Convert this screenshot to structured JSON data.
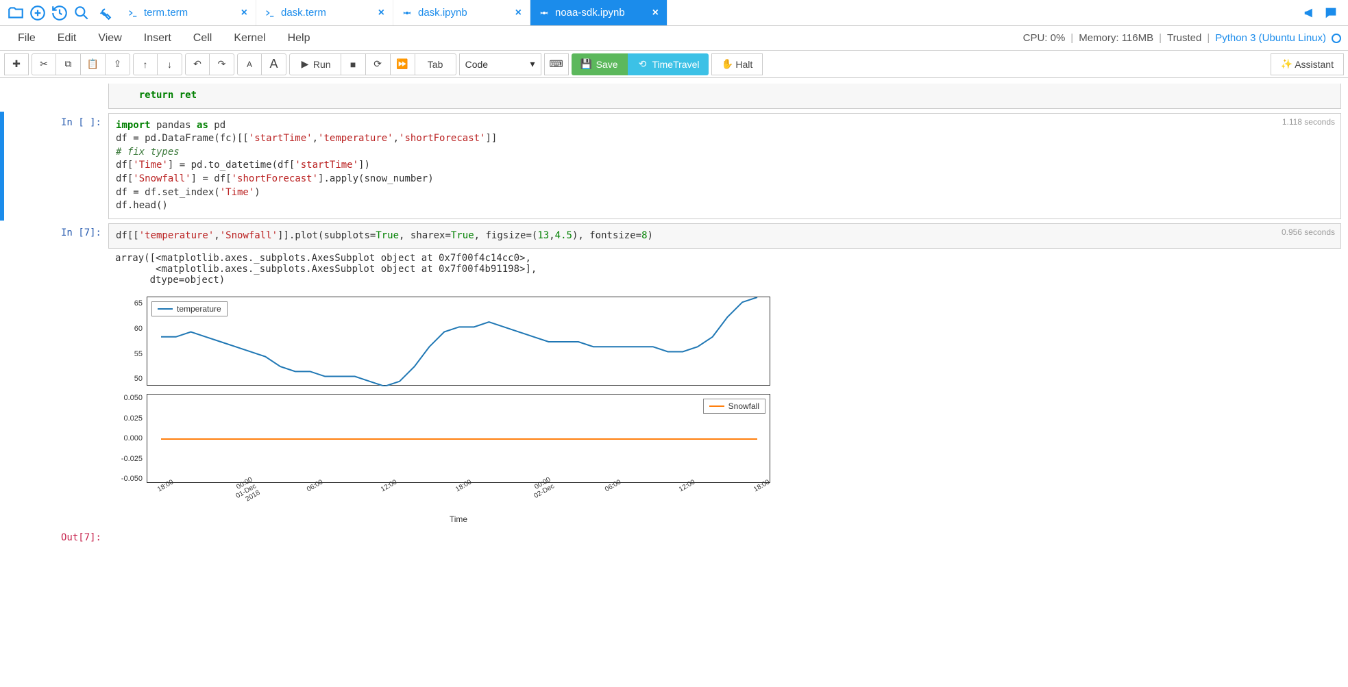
{
  "tabs": [
    {
      "label": "term.term",
      "icon": "terminal"
    },
    {
      "label": "dask.term",
      "icon": "terminal"
    },
    {
      "label": "dask.ipynb",
      "icon": "jupyter"
    },
    {
      "label": "noaa-sdk.ipynb",
      "icon": "jupyter",
      "active": true
    }
  ],
  "menubar": [
    "File",
    "Edit",
    "View",
    "Insert",
    "Cell",
    "Kernel",
    "Help"
  ],
  "status": {
    "cpu": "CPU: 0%",
    "memory": "Memory: 116MB",
    "trusted": "Trusted",
    "kernel": "Python 3 (Ubuntu Linux)"
  },
  "toolbar": {
    "run": "Run",
    "tab": "Tab",
    "celltype": "Code",
    "save": "Save",
    "timetravel": "TimeTravel",
    "halt": "Halt",
    "assistant": "Assistant"
  },
  "cells": {
    "prev_tail": "    return ret",
    "c1": {
      "prompt": "In [ ]:",
      "timing": "1.118 seconds",
      "lines": {
        "l1a": "import",
        "l1b": " pandas ",
        "l1c": "as",
        "l1d": " pd",
        "l2a": "df = pd.DataFrame(fc)[[",
        "l2b": "'startTime'",
        "l2c": ",",
        "l2d": "'temperature'",
        "l2e": ",",
        "l2f": "'shortForecast'",
        "l2g": "]]",
        "l3": "# fix types",
        "l4a": "df[",
        "l4b": "'Time'",
        "l4c": "] = pd.to_datetime(df[",
        "l4d": "'startTime'",
        "l4e": "])",
        "l5a": "df[",
        "l5b": "'Snowfall'",
        "l5c": "] = df[",
        "l5d": "'shortForecast'",
        "l5e": "].apply(snow_number)",
        "l6a": "df = df.set_index(",
        "l6b": "'Time'",
        "l6c": ")",
        "l7": "df.head()"
      }
    },
    "c2": {
      "prompt": "In [7]:",
      "timing": "0.956 seconds",
      "line": {
        "a": "df[[",
        "b": "'temperature'",
        "c": ",",
        "d": "'Snowfall'",
        "e": "]].plot(subplots=",
        "f": "True",
        "g": ", sharex=",
        "h": "True",
        "i": ", figsize=(",
        "j": "13",
        "k": ",",
        "l": "4.5",
        "m": "), fontsize=",
        "n": "8",
        "o": ")"
      },
      "output": "array([<matplotlib.axes._subplots.AxesSubplot object at 0x7f00f4c14cc0>,\n       <matplotlib.axes._subplots.AxesSubplot object at 0x7f00f4b91198>],\n      dtype=object)"
    },
    "out7": "Out[7]:"
  },
  "chart_data": [
    {
      "type": "line",
      "title": "",
      "legend": "temperature",
      "legend_pos": "top-left",
      "color": "#1f77b4",
      "ylim": [
        48,
        66
      ],
      "yticks": [
        "65",
        "60",
        "55",
        "50"
      ],
      "x_categories": [
        "18:00",
        "00:00\n01-Dec\n2018",
        "06:00",
        "12:00",
        "18:00",
        "00:00\n02-Dec",
        "06:00",
        "12:00",
        "18:00"
      ],
      "xlabel": "Time",
      "values": [
        58,
        58,
        59,
        58,
        57,
        56,
        55,
        54,
        52,
        51,
        51,
        50,
        50,
        50,
        49,
        48,
        49,
        52,
        56,
        59,
        60,
        60,
        61,
        60,
        59,
        58,
        57,
        57,
        57,
        56,
        56,
        56,
        56,
        56,
        55,
        55,
        56,
        58,
        62,
        65,
        66
      ]
    },
    {
      "type": "line",
      "title": "",
      "legend": "Snowfall",
      "legend_pos": "top-right",
      "color": "#ff7f0e",
      "ylim": [
        -0.05,
        0.05
      ],
      "yticks": [
        "0.050",
        "0.025",
        "0.000",
        "-0.025",
        "-0.050"
      ],
      "x_categories": [
        "18:00",
        "00:00\n01-Dec\n2018",
        "06:00",
        "12:00",
        "18:00",
        "00:00\n02-Dec",
        "06:00",
        "12:00",
        "18:00"
      ],
      "xlabel": "Time",
      "values": [
        0,
        0,
        0,
        0,
        0,
        0,
        0,
        0,
        0,
        0,
        0,
        0,
        0,
        0,
        0,
        0,
        0,
        0,
        0,
        0,
        0,
        0,
        0,
        0,
        0,
        0,
        0,
        0,
        0,
        0,
        0,
        0,
        0,
        0,
        0,
        0,
        0,
        0,
        0,
        0,
        0
      ]
    }
  ]
}
